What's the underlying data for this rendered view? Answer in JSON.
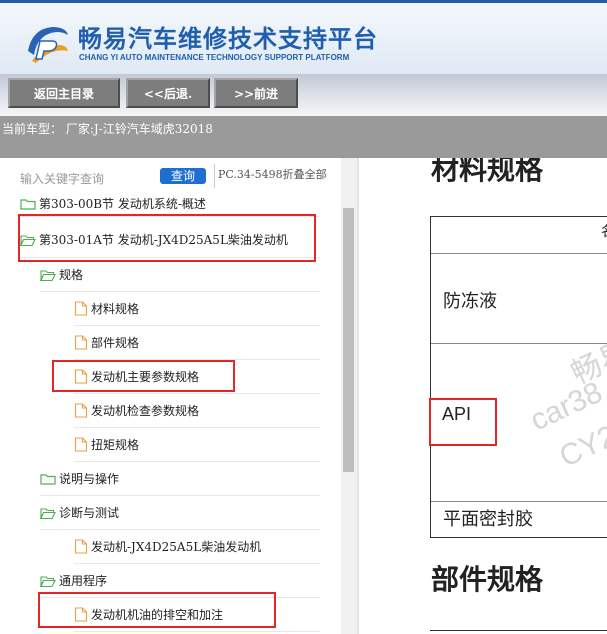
{
  "header": {
    "title": "畅易汽车维修技术支持平台",
    "subtitle": "CHANG YI AUTO MAINTENANCE TECHNOLOGY SUPPORT PLATFORM"
  },
  "nav": {
    "home": "返回主目录",
    "back": "<<后退.",
    "forward": ">>前进"
  },
  "vehicle": {
    "text": "当前车型：  厂家:J-江铃汽车域虎32018"
  },
  "tree": {
    "search_label": "输入关键字查询",
    "search_button": "查询",
    "pc_label": "PC.34-5498折叠全部",
    "items": [
      {
        "label": "第303-00B节 发动机系统-概述"
      },
      {
        "label": "第303-01A节 发动机-JX4D25A5L柴油发动机"
      },
      {
        "label": "规格"
      },
      {
        "label": "材料规格"
      },
      {
        "label": "部件规格"
      },
      {
        "label": "发动机主要参数规格"
      },
      {
        "label": "发动机检查参数规格"
      },
      {
        "label": "扭矩规格"
      },
      {
        "label": "说明与操作"
      },
      {
        "label": "诊断与测试"
      },
      {
        "label": "发动机-JX4D25A5L柴油发动机"
      },
      {
        "label": "通用程序"
      },
      {
        "label": "发动机机油的排空和加注"
      }
    ]
  },
  "content": {
    "heading_materials": "材料规格",
    "header_cell_partial": "名",
    "cells": [
      "防冻液",
      "API",
      "平面密封胶"
    ],
    "watermark": [
      "畅易",
      "car38",
      "CY2"
    ],
    "heading_parts": "部件规格"
  }
}
